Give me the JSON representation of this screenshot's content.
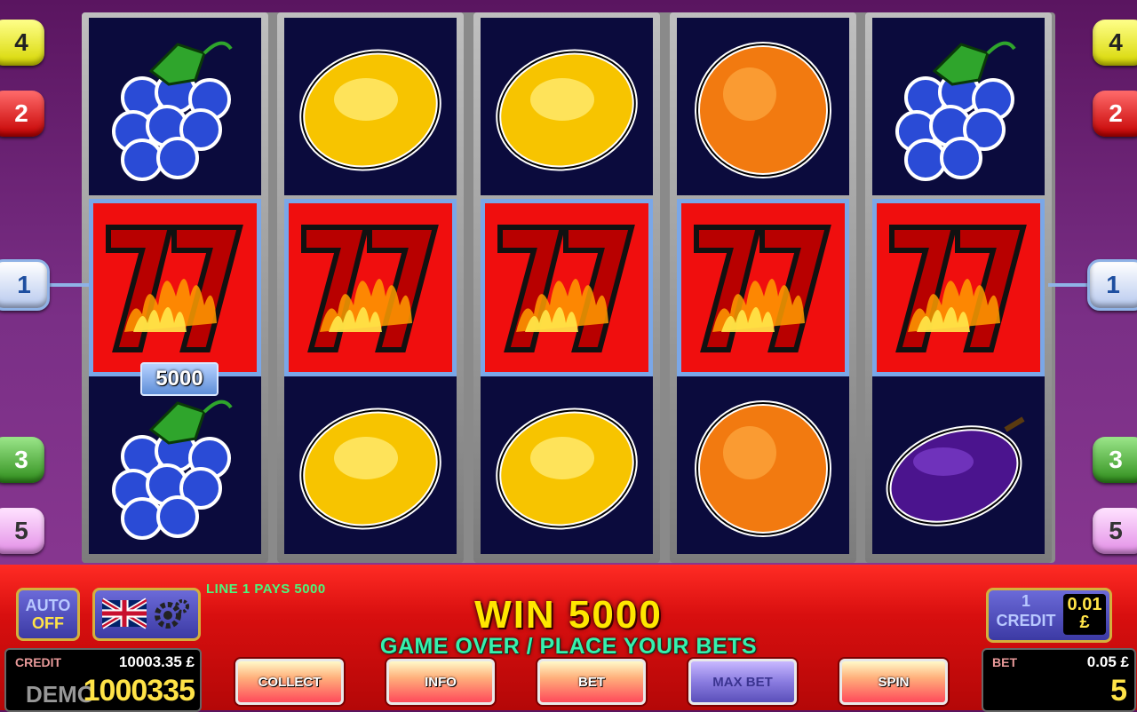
{
  "line_buttons": {
    "left": [
      "4",
      "2",
      "1",
      "3",
      "5"
    ],
    "right": [
      "4",
      "2",
      "1",
      "3",
      "5"
    ]
  },
  "reels": [
    {
      "symbols": [
        "grapes",
        "seven",
        "grapes"
      ]
    },
    {
      "symbols": [
        "lemon",
        "seven",
        "lemon"
      ]
    },
    {
      "symbols": [
        "lemon",
        "seven",
        "lemon"
      ]
    },
    {
      "symbols": [
        "orange",
        "seven",
        "orange"
      ]
    },
    {
      "symbols": [
        "grapes",
        "seven",
        "plum"
      ]
    }
  ],
  "win_badge": "5000",
  "panel": {
    "auto": {
      "label": "AUTO",
      "state": "OFF"
    },
    "line_pays": "LINE 1 PAYS 5000",
    "win_text": "WIN 5000",
    "status": "GAME OVER / PLACE YOUR BETS",
    "credit": {
      "label": "CREDIT",
      "money": "10003.35 £",
      "amount": "1000335",
      "demo": "DEMO"
    },
    "denomination": {
      "count": "1",
      "label": "CREDIT",
      "value": "0.01",
      "currency": "£"
    },
    "bet": {
      "label": "BET",
      "money": "0.05 £",
      "amount": "5"
    },
    "buttons": {
      "collect": "COLLECT",
      "info": "INFO",
      "bet": "BET",
      "max_bet": "MAX BET",
      "spin": "SPIN"
    }
  },
  "colors": {
    "panel_red": "#d80f0f",
    "win_yellow": "#ffe700",
    "status_green": "#37f0ad",
    "reel_bg": "#0b0b3d",
    "win_cell": "#f00e0e"
  }
}
